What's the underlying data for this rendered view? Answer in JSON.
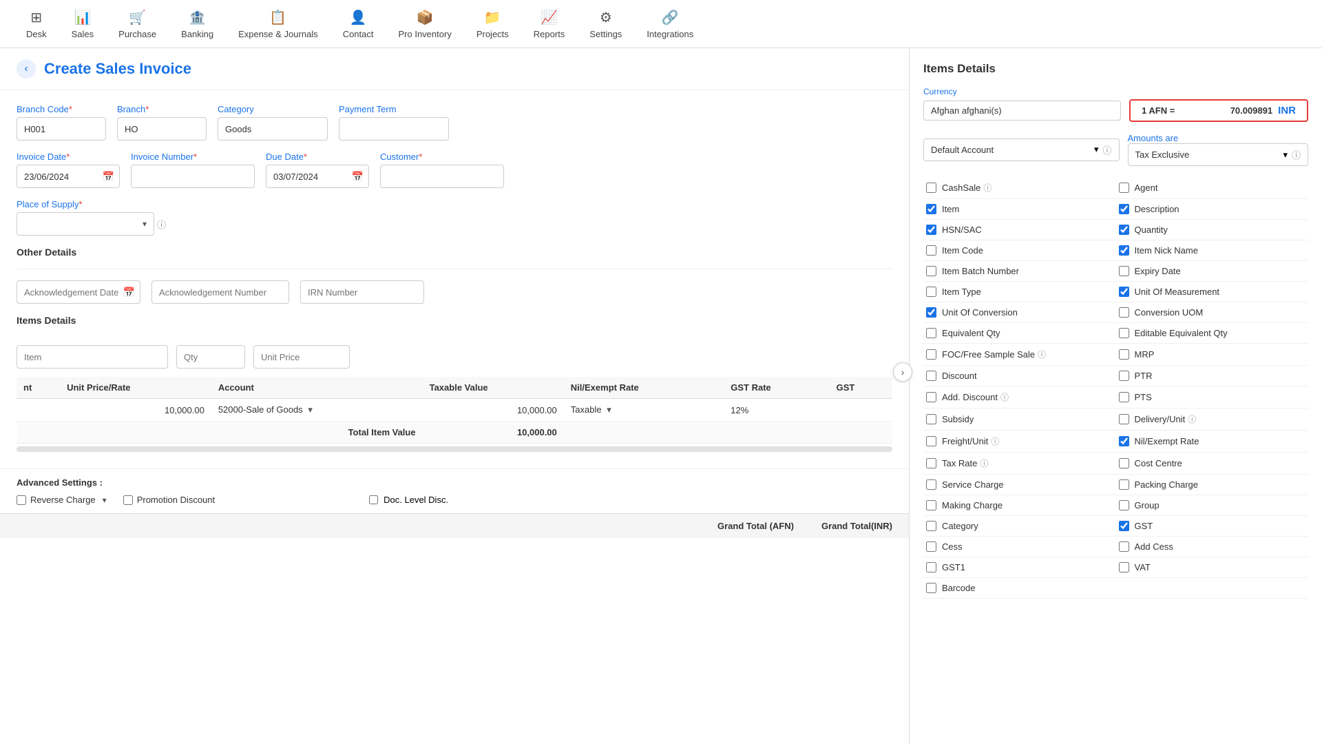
{
  "nav": {
    "items": [
      {
        "id": "desk",
        "label": "Desk",
        "icon": "⊞"
      },
      {
        "id": "sales",
        "label": "Sales",
        "icon": "📊"
      },
      {
        "id": "purchase",
        "label": "Purchase",
        "icon": "🛒"
      },
      {
        "id": "banking",
        "label": "Banking",
        "icon": "🏦"
      },
      {
        "id": "expense",
        "label": "Expense & Journals",
        "icon": "📋"
      },
      {
        "id": "contact",
        "label": "Contact",
        "icon": "👤"
      },
      {
        "id": "proinventory",
        "label": "Pro Inventory",
        "icon": "📦"
      },
      {
        "id": "projects",
        "label": "Projects",
        "icon": "📁"
      },
      {
        "id": "reports",
        "label": "Reports",
        "icon": "📈"
      },
      {
        "id": "settings",
        "label": "Settings",
        "icon": "⚙"
      },
      {
        "id": "integrations",
        "label": "Integrations",
        "icon": "🔗"
      }
    ]
  },
  "page": {
    "title": "Create Sales Invoice",
    "back_label": "‹"
  },
  "form": {
    "branch_code_label": "Branch Code",
    "branch_code_value": "H001",
    "branch_label": "Branch",
    "branch_value": "HO",
    "category_label": "Category",
    "category_value": "Goods",
    "payment_term_label": "Payment Term",
    "invoice_date_label": "Invoice Date",
    "invoice_date_value": "23/06/2024",
    "invoice_number_label": "Invoice Number",
    "due_date_label": "Due Date",
    "due_date_value": "03/07/2024",
    "customer_label": "Customer",
    "place_of_supply_label": "Place of Supply",
    "other_details_title": "Other Details",
    "ack_date_label": "Acknowledgement Date",
    "ack_number_label": "Acknowledgement Number",
    "irn_number_label": "IRN Number",
    "items_title": "Items Details",
    "item_placeholder": "Item",
    "qty_placeholder": "Qty",
    "unit_price_placeholder": "Unit Price"
  },
  "table": {
    "columns": [
      "nt",
      "Unit Price/Rate",
      "Account",
      "Taxable Value",
      "Nil/Exempt Rate",
      "GST Rate",
      "GST"
    ],
    "rows": [
      {
        "nt": "",
        "unit_price_rate": "10,000.00",
        "account": "52000-Sale of Goods",
        "taxable_value": "10,000.00",
        "nil_exempt": "Taxable",
        "gst_rate": "12%",
        "gst": ""
      }
    ],
    "total_label": "Total Item Value",
    "total_value": "10,000.00"
  },
  "advanced": {
    "title": "Advanced Settings :",
    "reverse_charge_label": "Reverse Charge",
    "promotion_discount_label": "Promotion Discount",
    "doc_level_disc_label": "Doc. Level Disc."
  },
  "grand_total": {
    "afn_label": "Grand Total (AFN)",
    "inr_label": "Grand Total(INR)"
  },
  "items_details_panel": {
    "title": "Items Details",
    "currency_label": "Currency",
    "currency_value": "Afghan afghani(s)",
    "exchange_prefix": "1 AFN =",
    "exchange_rate": "70.009891",
    "exchange_currency": "INR",
    "amounts_label": "Amounts are",
    "amounts_value": "Tax Exclusive",
    "default_account_label": "Default Account",
    "checkboxes_left": [
      {
        "id": "cashsale",
        "label": "CashSale",
        "checked": false,
        "has_info": true
      },
      {
        "id": "item",
        "label": "Item",
        "checked": true,
        "has_info": false
      },
      {
        "id": "hsnsac",
        "label": "HSN/SAC",
        "checked": true,
        "has_info": false
      },
      {
        "id": "itemcode",
        "label": "Item Code",
        "checked": false,
        "has_info": false
      },
      {
        "id": "itembatch",
        "label": "Item Batch Number",
        "checked": false,
        "has_info": false
      },
      {
        "id": "itemtype",
        "label": "Item Type",
        "checked": false,
        "has_info": false
      },
      {
        "id": "unitconversion",
        "label": "Unit Of Conversion",
        "checked": true,
        "has_info": false
      },
      {
        "id": "equivqty",
        "label": "Equivalent Qty",
        "checked": false,
        "has_info": false
      },
      {
        "id": "foc",
        "label": "FOC/Free Sample Sale",
        "checked": false,
        "has_info": true
      },
      {
        "id": "discount",
        "label": "Discount",
        "checked": false,
        "has_info": false
      },
      {
        "id": "adddiscount",
        "label": "Add. Discount",
        "checked": false,
        "has_info": true
      },
      {
        "id": "subsidy",
        "label": "Subsidy",
        "checked": false,
        "has_info": false
      },
      {
        "id": "freightunit",
        "label": "Freight/Unit",
        "checked": false,
        "has_info": true
      },
      {
        "id": "taxrate",
        "label": "Tax Rate",
        "checked": false,
        "has_info": true
      },
      {
        "id": "servicecharge",
        "label": "Service Charge",
        "checked": false,
        "has_info": false
      },
      {
        "id": "makingcharge",
        "label": "Making Charge",
        "checked": false,
        "has_info": false
      },
      {
        "id": "category",
        "label": "Category",
        "checked": false,
        "has_info": false
      },
      {
        "id": "cess",
        "label": "Cess",
        "checked": false,
        "has_info": false
      },
      {
        "id": "gst1",
        "label": "GST1",
        "checked": false,
        "has_info": false
      },
      {
        "id": "barcode",
        "label": "Barcode",
        "checked": false,
        "has_info": false
      }
    ],
    "checkboxes_right": [
      {
        "id": "agent",
        "label": "Agent",
        "checked": false,
        "has_info": false
      },
      {
        "id": "description",
        "label": "Description",
        "checked": true,
        "has_info": false
      },
      {
        "id": "quantity",
        "label": "Quantity",
        "checked": true,
        "has_info": false
      },
      {
        "id": "itemnickname",
        "label": "Item Nick Name",
        "checked": true,
        "has_info": false
      },
      {
        "id": "expirydate",
        "label": "Expiry Date",
        "checked": false,
        "has_info": false
      },
      {
        "id": "uom",
        "label": "Unit Of Measurement",
        "checked": true,
        "has_info": false
      },
      {
        "id": "conversionuom",
        "label": "Conversion UOM",
        "checked": false,
        "has_info": false
      },
      {
        "id": "editequivqty",
        "label": "Editable Equivalent Qty",
        "checked": false,
        "has_info": false
      },
      {
        "id": "mrp",
        "label": "MRP",
        "checked": false,
        "has_info": false
      },
      {
        "id": "ptr",
        "label": "PTR",
        "checked": false,
        "has_info": false
      },
      {
        "id": "pts",
        "label": "PTS",
        "checked": false,
        "has_info": false
      },
      {
        "id": "deliveryunit",
        "label": "Delivery/Unit",
        "checked": false,
        "has_info": true
      },
      {
        "id": "nilexemptrate",
        "label": "Nil/Exempt Rate",
        "checked": true,
        "has_info": false
      },
      {
        "id": "costcentre",
        "label": "Cost Centre",
        "checked": false,
        "has_info": false
      },
      {
        "id": "packingcharge",
        "label": "Packing Charge",
        "checked": false,
        "has_info": false
      },
      {
        "id": "group",
        "label": "Group",
        "checked": false,
        "has_info": false
      },
      {
        "id": "gst",
        "label": "GST",
        "checked": true,
        "has_info": false
      },
      {
        "id": "addcess",
        "label": "Add Cess",
        "checked": false,
        "has_info": false
      },
      {
        "id": "vat",
        "label": "VAT",
        "checked": false,
        "has_info": false
      }
    ]
  }
}
